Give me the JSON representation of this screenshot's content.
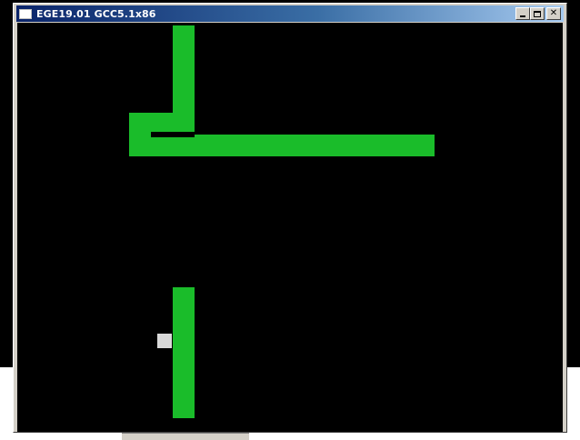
{
  "window": {
    "title": "EGE19.01 GCC5.1x86",
    "app_icon": "window-icon",
    "buttons": {
      "minimize_icon": "minimize-icon",
      "maximize_icon": "maximize-icon",
      "close_icon": "close-icon",
      "close_glyph": "✕"
    }
  },
  "game": {
    "background_color": "#000000",
    "snake_color": "#1abc2a",
    "food_color": "#d9d9d9",
    "obstacles": [
      {
        "name": "snake-segment-vertical-top",
        "col": 7,
        "row": 0,
        "cols": 1,
        "rows": 5
      },
      {
        "name": "snake-segment-elbow",
        "col": 5,
        "row": 4,
        "cols": 3,
        "rows": 1
      },
      {
        "name": "snake-segment-corner",
        "col": 5,
        "row": 5,
        "cols": 1,
        "rows": 1
      },
      {
        "name": "snake-segment-horizontal",
        "col": 5,
        "row": 5,
        "cols": 14,
        "rows": 1
      },
      {
        "name": "snake-segment-vertical-bottom",
        "col": 7,
        "row": 12,
        "cols": 1,
        "rows": 6
      }
    ],
    "food": {
      "col": 6,
      "row": 14
    }
  }
}
